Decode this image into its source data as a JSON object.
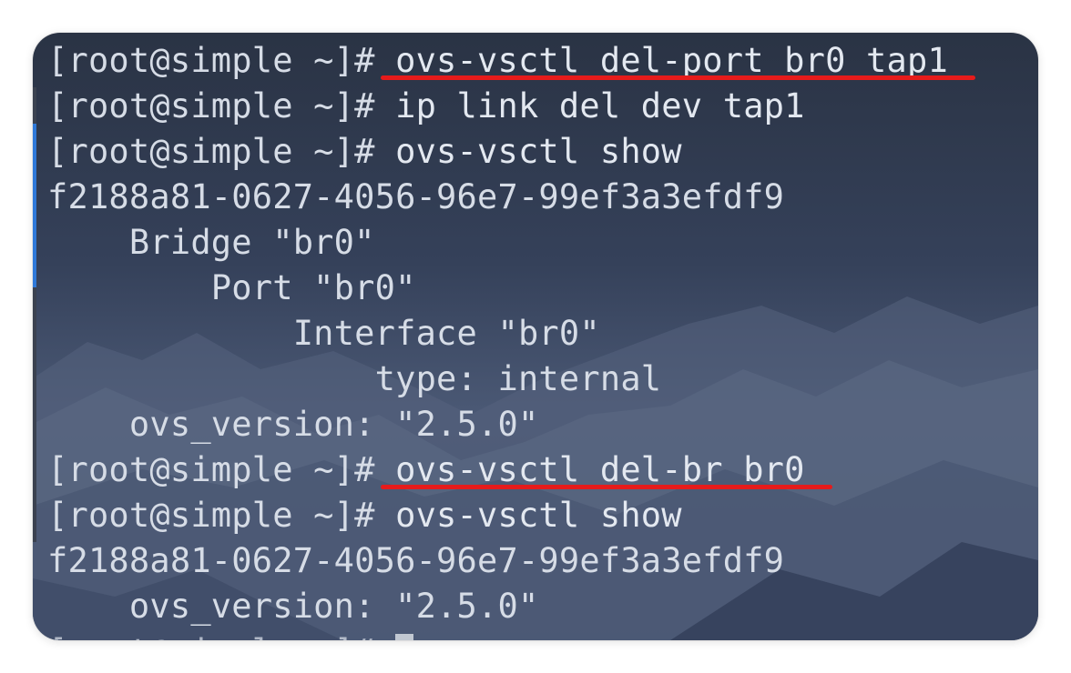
{
  "terminal": {
    "lines": [
      {
        "prompt": "[root@simple ~]#",
        "cmd": " ovs-vsctl del-port br0 tap1",
        "highlight": true
      },
      {
        "prompt": "[root@simple ~]#",
        "cmd": " ip link del dev tap1"
      },
      {
        "prompt": "[root@simple ~]#",
        "cmd": " ovs-vsctl show"
      },
      {
        "output": "f2188a81-0627-4056-96e7-99ef3a3efdf9"
      },
      {
        "output": "    Bridge \"br0\""
      },
      {
        "output": "        Port \"br0\""
      },
      {
        "output": "            Interface \"br0\""
      },
      {
        "output": "                type: internal"
      },
      {
        "output": "    ovs_version: \"2.5.0\""
      },
      {
        "prompt": "[root@simple ~]#",
        "cmd": " ovs-vsctl del-br br0",
        "highlight": true
      },
      {
        "prompt": "[root@simple ~]#",
        "cmd": " ovs-vsctl show"
      },
      {
        "output": "f2188a81-0627-4056-96e7-99ef3a3efdf9"
      },
      {
        "output": "    ovs_version: \"2.5.0\""
      },
      {
        "prompt": "[root@simple ~]#",
        "cmd": " ",
        "cursor": true,
        "partial": true
      }
    ],
    "highlight_color": "#e61b1b",
    "text_color": "#dde3ec",
    "background_color": "#35415a"
  }
}
